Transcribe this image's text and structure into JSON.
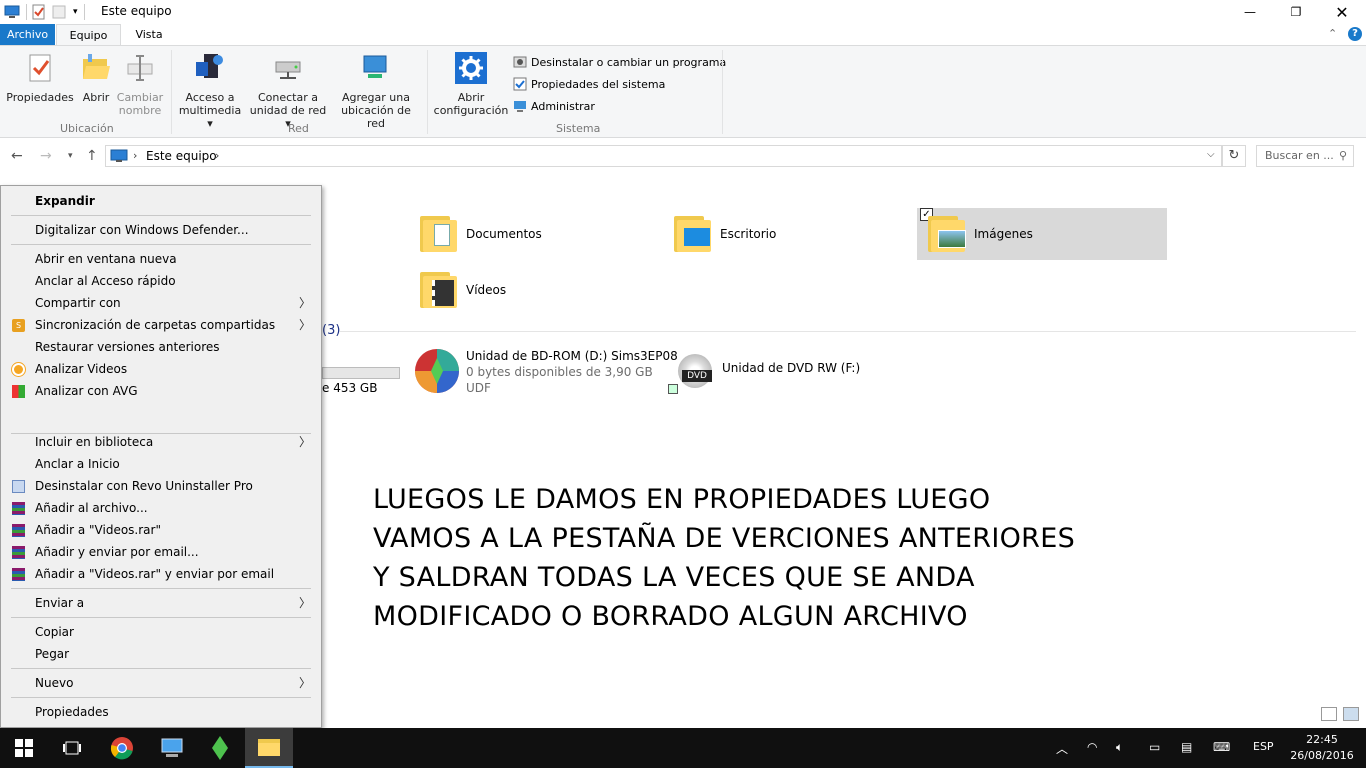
{
  "window": {
    "title": "Este equipo"
  },
  "tabs": {
    "file": "Archivo",
    "equipo": "Equipo",
    "vista": "Vista"
  },
  "ribbon": {
    "propiedades": "Propiedades",
    "abrir": "Abrir",
    "cambiar_nombre_1": "Cambiar",
    "cambiar_nombre_2": "nombre",
    "group_ubicacion": "Ubicación",
    "acceso_1": "Acceso a",
    "acceso_2": "multimedia ▾",
    "conectar_1": "Conectar a",
    "conectar_2": "unidad de red ▾",
    "agregar_1": "Agregar una",
    "agregar_2": "ubicación de red",
    "group_red": "Red",
    "abrir_conf_1": "Abrir",
    "abrir_conf_2": "configuración",
    "desinstalar": "Desinstalar o cambiar un programa",
    "prop_sistema": "Propiedades del sistema",
    "administrar": "Administrar",
    "group_sistema": "Sistema"
  },
  "address": {
    "location": "Este equipo",
    "search_placeholder": "Buscar en ..."
  },
  "folders": {
    "documentos": "Documentos",
    "escritorio": "Escritorio",
    "imagenes": "Imágenes",
    "videos": "Vídeos"
  },
  "devices": {
    "header_count": "(3)",
    "c_free": "e 453 GB",
    "bd_name": "Unidad de BD-ROM (D:) Sims3EP08",
    "bd_free": "0 bytes disponibles de 3,90 GB",
    "bd_fs": "UDF",
    "dvd_name": "Unidad de DVD RW (F:)",
    "dvd_badge": "DVD"
  },
  "overlay": {
    "line1": "LUEGOS LE DAMOS EN PROPIEDADES LUEGO",
    "line2": "VAMOS A LA PESTAÑA DE VERCIONES ANTERIORES",
    "line3": "Y SALDRAN TODAS LA VECES QUE SE ANDA",
    "line4": "MODIFICADO O BORRADO ALGUN ARCHIVO"
  },
  "context_menu": {
    "expandir": "Expandir",
    "defender": "Digitalizar con Windows Defender...",
    "nueva_ventana": "Abrir en ventana nueva",
    "anclar_acceso": "Anclar al Acceso rápido",
    "compartir": "Compartir con",
    "sincronizacion": "Sincronización de carpetas compartidas",
    "restaurar": "Restaurar versiones anteriores",
    "analizar_videos": "Analizar Videos",
    "analizar_avg": "Analizar con AVG",
    "incluir": "Incluir en biblioteca",
    "anclar_inicio": "Anclar a Inicio",
    "revo": "Desinstalar con Revo Uninstaller Pro",
    "anadir_archivo": "Añadir al archivo...",
    "anadir_rar": "Añadir a \"Videos.rar\"",
    "anadir_email": "Añadir y enviar por email...",
    "anadir_rar_email": "Añadir a \"Videos.rar\" y enviar por email",
    "enviar": "Enviar a",
    "copiar": "Copiar",
    "pegar": "Pegar",
    "nuevo": "Nuevo",
    "propiedades": "Propiedades"
  },
  "taskbar": {
    "lang": "ESP",
    "time": "22:45",
    "date": "26/08/2016"
  }
}
